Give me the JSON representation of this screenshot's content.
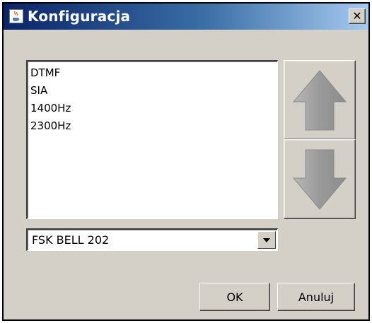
{
  "window": {
    "title": "Konfiguracja",
    "app_icon": "java-cup-icon",
    "close_label": "✕"
  },
  "list": {
    "items": [
      "DTMF",
      "SIA",
      "1400Hz",
      "2300Hz"
    ]
  },
  "move_buttons": {
    "up_icon": "arrow-up-icon",
    "down_icon": "arrow-down-icon"
  },
  "combo": {
    "selected": "FSK BELL 202",
    "arrow_icon": "chevron-down-icon"
  },
  "buttons": {
    "ok_label": "OK",
    "cancel_label": "Anuluj"
  },
  "colors": {
    "titlebar_start": "#0a246a",
    "titlebar_end": "#a6caf0",
    "dialog_background": "#d4d0c8",
    "arrow_gray": "#9a9a9a"
  }
}
